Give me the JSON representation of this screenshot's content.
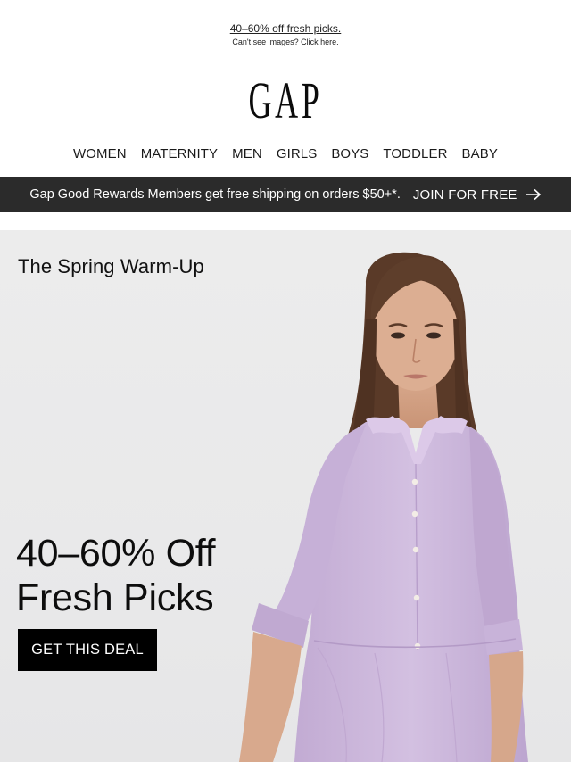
{
  "preheader": {
    "promo_link": "40–60% off fresh picks.",
    "cant_see_prefix": "Can't see images?",
    "click_here": "Click here",
    "period": "."
  },
  "logo": {
    "text": "GAP"
  },
  "nav": {
    "items": [
      {
        "label": "WOMEN"
      },
      {
        "label": "MATERNITY"
      },
      {
        "label": "MEN"
      },
      {
        "label": "GIRLS"
      },
      {
        "label": "BOYS"
      },
      {
        "label": "TODDLER"
      },
      {
        "label": "BABY"
      }
    ]
  },
  "rewards_bar": {
    "message": "Gap Good Rewards Members get free shipping on orders $50+*.",
    "join_label": "JOIN FOR FREE",
    "join_icon": "arrow-right-icon",
    "background": "#2b2b2b"
  },
  "hero": {
    "eyebrow": "The Spring Warm-Up",
    "headline_line1": "40–60% Off",
    "headline_line2": "Fresh Picks",
    "cta_label": "GET THIS DEAL",
    "image": "model-in-lavender-tiered-dress",
    "background": "#ececec",
    "dress_color": "#cdb8dc"
  }
}
